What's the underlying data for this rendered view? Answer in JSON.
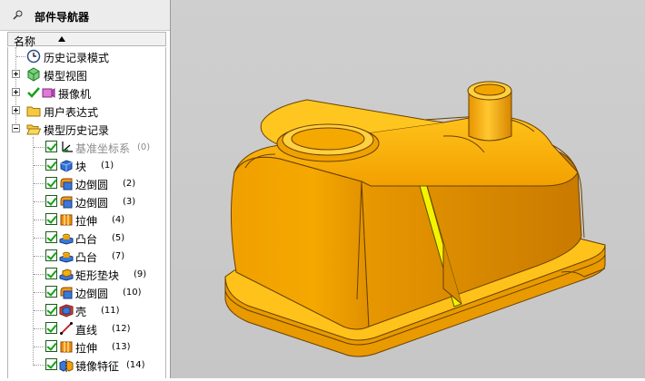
{
  "navigator": {
    "title": "部件导航器",
    "column_header": "名称"
  },
  "tree": {
    "top_items": [
      {
        "label": "历史记录模式",
        "icon": "clock-icon"
      },
      {
        "label": "模型视图",
        "icon": "model-views-icon"
      },
      {
        "label": "摄像机",
        "icon": "camera-icon"
      },
      {
        "label": "用户表达式",
        "icon": "folder-icon"
      },
      {
        "label": "模型历史记录",
        "icon": "folder-open-icon"
      }
    ],
    "features": [
      {
        "label": "基准坐标系",
        "num": "(0)",
        "icon": "datum-csys-icon"
      },
      {
        "label": "块",
        "num": "(1)",
        "icon": "block-icon"
      },
      {
        "label": "边倒圆",
        "num": "(2)",
        "icon": "edge-blend-icon"
      },
      {
        "label": "边倒圆",
        "num": "(3)",
        "icon": "edge-blend-icon"
      },
      {
        "label": "拉伸",
        "num": "(4)",
        "icon": "extrude-icon"
      },
      {
        "label": "凸台",
        "num": "(5)",
        "icon": "boss-icon"
      },
      {
        "label": "凸台",
        "num": "(7)",
        "icon": "boss-icon"
      },
      {
        "label": "矩形垫块",
        "num": "(9)",
        "icon": "rect-pad-icon"
      },
      {
        "label": "边倒圆",
        "num": "(10)",
        "icon": "edge-blend-icon"
      },
      {
        "label": "壳",
        "num": "(11)",
        "icon": "shell-icon"
      },
      {
        "label": "直线",
        "num": "(12)",
        "icon": "line-icon"
      },
      {
        "label": "拉伸",
        "num": "(13)",
        "icon": "extrude-icon"
      },
      {
        "label": "镜像特征",
        "num": "(14)",
        "icon": "mirror-feature-icon"
      }
    ]
  },
  "colors": {
    "part_orange": "#f2a400",
    "part_highlight": "#ffd030",
    "rib_yellow": "#f4f400",
    "background": "#c9c9c9"
  }
}
